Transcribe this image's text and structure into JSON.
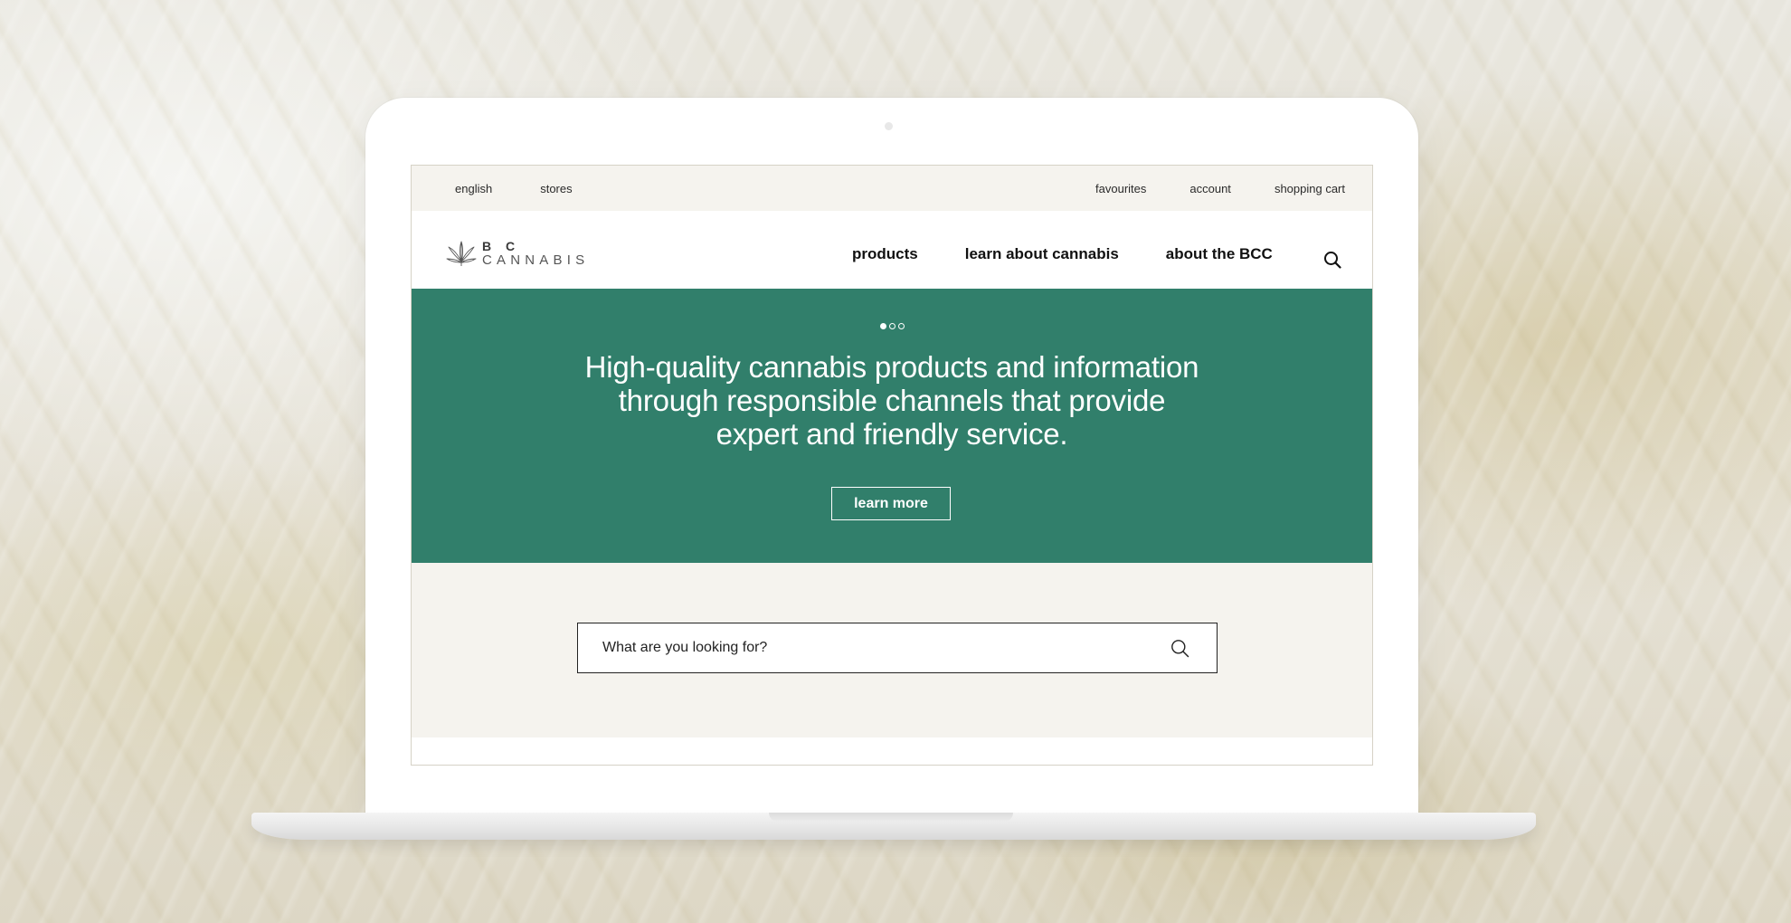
{
  "utility_bar": {
    "left_links": [
      "english",
      "stores"
    ],
    "right_links": [
      "favourites",
      "account",
      "shopping cart"
    ]
  },
  "header": {
    "logo": {
      "line1": "B C",
      "line2": "CANNABIS"
    },
    "nav_items": [
      "products",
      "learn about cannabis",
      "about the BCC"
    ],
    "search_icon": "search-icon"
  },
  "hero": {
    "carousel_total": 3,
    "carousel_active": 1,
    "headline_lines": [
      "High-quality cannabis products and information",
      "through responsible channels that provide",
      "expert and friendly service."
    ],
    "cta_label": "learn more",
    "background_color": "#317f6b"
  },
  "search": {
    "placeholder": "What are you looking for?",
    "icon": "search-icon"
  }
}
